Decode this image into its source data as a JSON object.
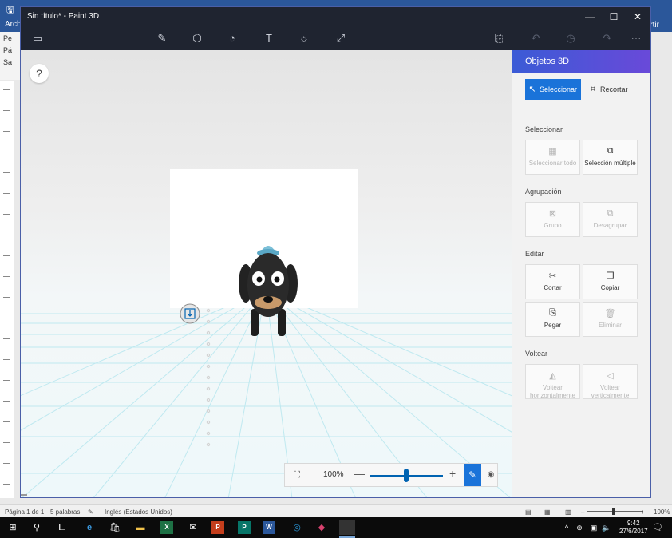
{
  "word": {
    "ribbon_left": "Archi",
    "ribbon_right": "rtir",
    "side_items": [
      "Pe",
      "Pá",
      "Sa"
    ],
    "status": {
      "page": "Página 1 de 1",
      "words": "5 palabras",
      "language": "Inglés (Estados Unidos)",
      "zoom": "100%"
    }
  },
  "paint3d": {
    "title": "Sin título* - Paint 3D",
    "zoom_label": "100%",
    "zoom_level_fraction": 0.5,
    "panel": {
      "header": "Objetos 3D",
      "select_btn": "Seleccionar",
      "crop_btn": "Recortar",
      "sections": {
        "select": "Seleccionar",
        "group": "Agrupación",
        "edit": "Editar",
        "flip": "Voltear"
      },
      "tiles": {
        "select_all": "Seleccionar todo",
        "multi_select": "Selección múltiple",
        "group": "Grupo",
        "ungroup": "Desagrupar",
        "cut": "Cortar",
        "copy": "Copiar",
        "paste": "Pegar",
        "delete": "Eliminar",
        "flip_h": "Voltear horizontalmente",
        "flip_v": "Voltear verticalmente"
      }
    }
  },
  "taskbar": {
    "time": "9:42",
    "date": "27/6/2017"
  },
  "colors": {
    "accent": "#1a73d9",
    "panel_gradient_start": "#3b5bd6",
    "panel_gradient_end": "#6a49d9",
    "titlebar": "#1f2430",
    "word_blue": "#2b579a"
  }
}
